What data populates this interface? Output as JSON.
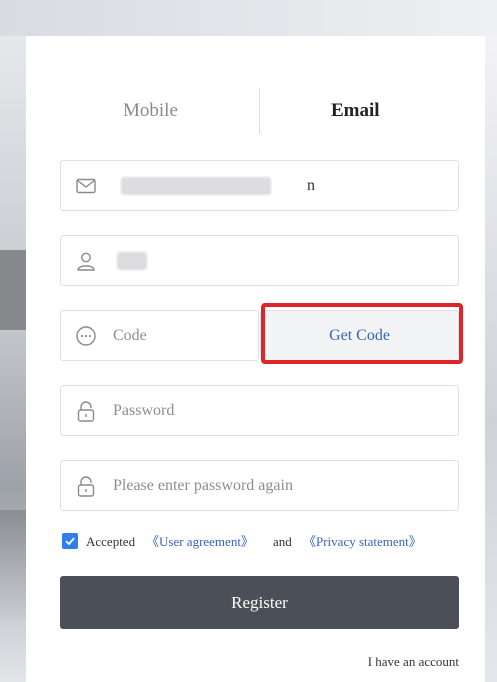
{
  "tabs": {
    "mobile": "Mobile",
    "email": "Email",
    "active": "Email"
  },
  "form": {
    "email_value_tail": "n",
    "username_value_head": "",
    "code_placeholder": "Code",
    "get_code_label": "Get Code",
    "password_placeholder": "Password",
    "password_confirm_placeholder": "Please enter password again"
  },
  "agreement": {
    "checked": true,
    "prefix": "Accepted",
    "user_agreement": "《User agreement》",
    "and": "and",
    "privacy": "《Privacy statement》"
  },
  "register_label": "Register",
  "have_account_label": "I have an account",
  "colors": {
    "link": "#3a62b8",
    "button": "#4b4f57",
    "highlight": "#e0242a",
    "checkbox": "#2f80ed"
  },
  "icons": [
    "mail-icon",
    "user-icon",
    "chat-bubble-icon",
    "lock-icon",
    "lock-icon",
    "check-icon"
  ]
}
